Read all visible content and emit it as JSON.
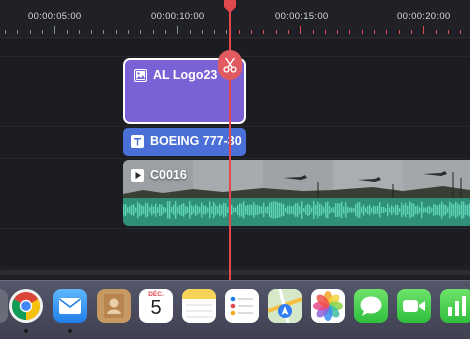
{
  "ruler": {
    "timecodes": [
      "00:00:05:00",
      "00:00:10:00",
      "00:00:15:00",
      "00:00:20:00"
    ]
  },
  "timeline": {
    "logo_clip": {
      "label": "AL Logo23",
      "type": "image"
    },
    "text_clip": {
      "label": "BOEING 777-30",
      "type": "text"
    },
    "video_clip": {
      "label": "C0016",
      "type": "video"
    }
  },
  "dock": {
    "calendar_month": "DÉC.",
    "calendar_day": "5"
  },
  "colors": {
    "playhead": "#e0484d",
    "logo_clip": "#7b61d6",
    "text_clip": "#4a6fd6",
    "audio_wave": "#4bbf9f"
  }
}
